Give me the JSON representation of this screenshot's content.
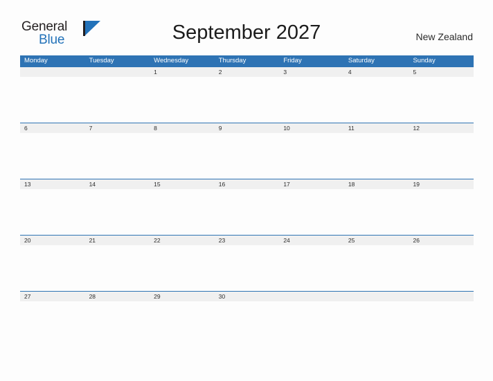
{
  "logo": {
    "text_top": "General",
    "text_bottom": "Blue",
    "triangle_color": "#2372b9",
    "text_top_color": "#231f20"
  },
  "header": {
    "title": "September 2027",
    "region": "New Zealand"
  },
  "theme": {
    "header_blue": "#2e73b4",
    "date_band_gray": "#f0f0f0",
    "page_background": "#fdfdfd",
    "text_color": "#2b2b2b"
  },
  "calendar": {
    "weekdays": [
      "Monday",
      "Tuesday",
      "Wednesday",
      "Thursday",
      "Friday",
      "Saturday",
      "Sunday"
    ],
    "weeks": [
      [
        "",
        "",
        "1",
        "2",
        "3",
        "4",
        "5"
      ],
      [
        "6",
        "7",
        "8",
        "9",
        "10",
        "11",
        "12"
      ],
      [
        "13",
        "14",
        "15",
        "16",
        "17",
        "18",
        "19"
      ],
      [
        "20",
        "21",
        "22",
        "23",
        "24",
        "25",
        "26"
      ],
      [
        "27",
        "28",
        "29",
        "30",
        "",
        "",
        ""
      ]
    ]
  }
}
